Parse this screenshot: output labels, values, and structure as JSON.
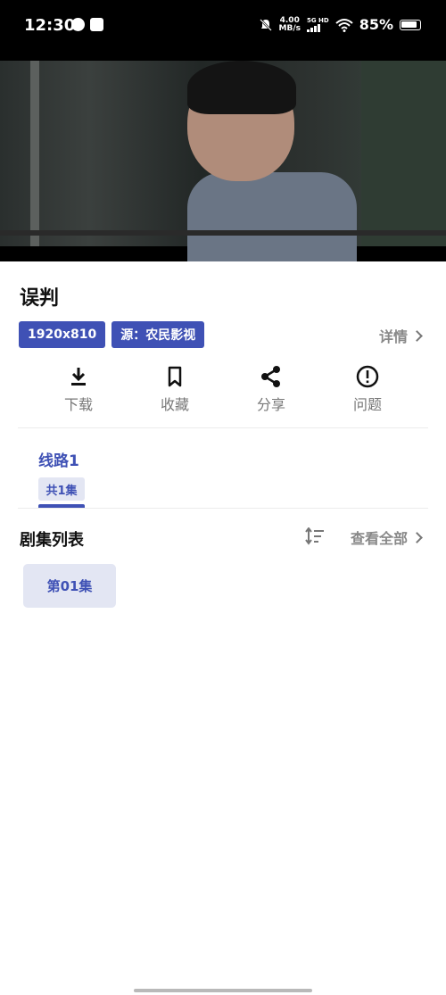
{
  "status_bar": {
    "time": "12:30",
    "net_speed_value": "4.00",
    "net_speed_unit": "MB/s",
    "network_type": "5G HD",
    "battery": "85%"
  },
  "video": {
    "player_icon": "video-frame"
  },
  "movie": {
    "title": "误判",
    "resolution_tag": "1920x810",
    "source_tag": "源：农民影视",
    "details_label": "详情"
  },
  "actions": [
    {
      "label": "下载",
      "icon": "download-icon"
    },
    {
      "label": "收藏",
      "icon": "bookmark-icon"
    },
    {
      "label": "分享",
      "icon": "share-icon"
    },
    {
      "label": "问题",
      "icon": "alert-icon"
    }
  ],
  "source_line": {
    "name": "线路1",
    "count": "共1集"
  },
  "episodes": {
    "header": "剧集列表",
    "view_all": "查看全部",
    "items": [
      {
        "label": "第01集"
      }
    ]
  },
  "colors": {
    "accent": "#3f51b5",
    "accent_light": "#e3e6f3",
    "muted_text": "#888888"
  }
}
